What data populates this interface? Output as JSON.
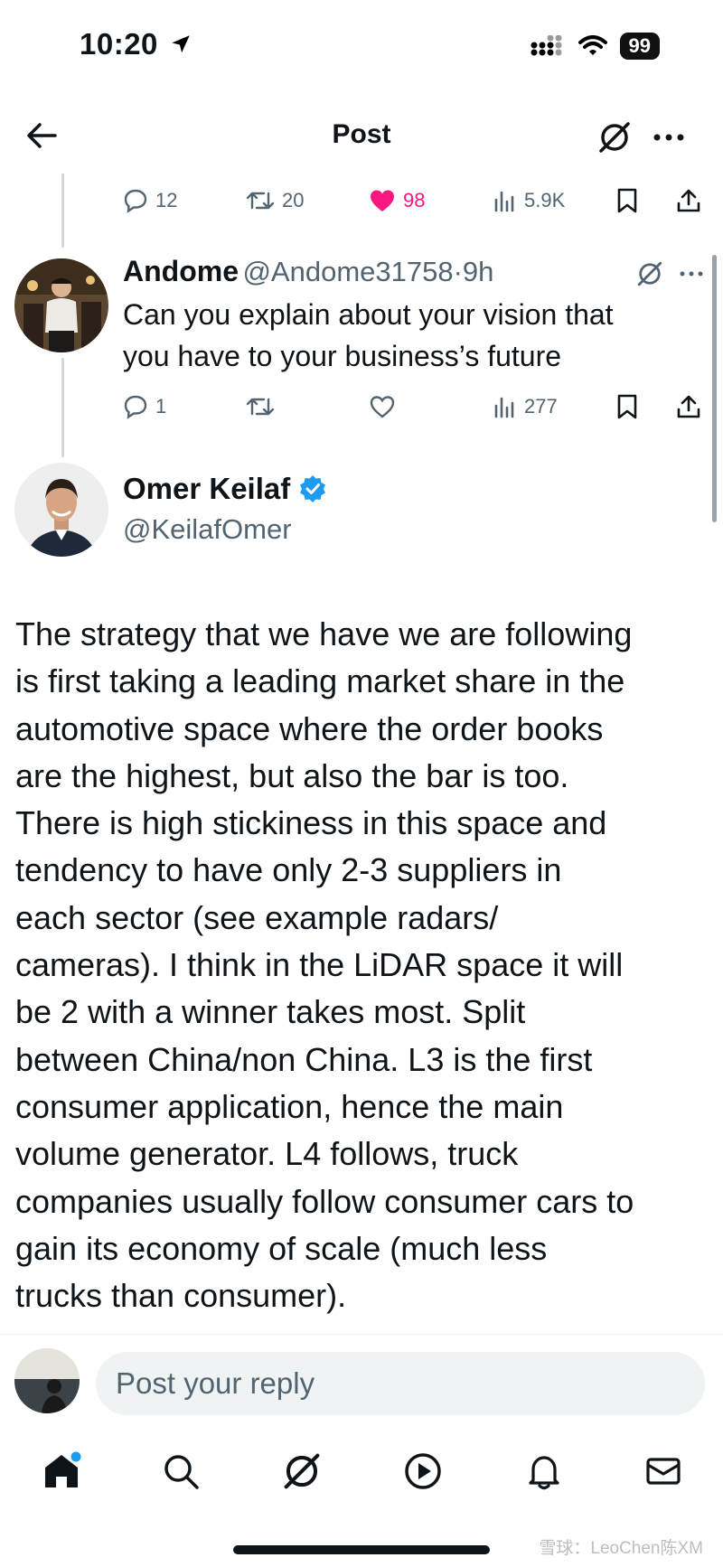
{
  "status_bar": {
    "time": "10:20",
    "battery": "99"
  },
  "header": {
    "title": "Post"
  },
  "parent_post": {
    "replies": "12",
    "reposts": "20",
    "likes": "98",
    "views": "5.9K"
  },
  "reply": {
    "author_name": "Andome",
    "handle": "@Andome31758",
    "separator": "·",
    "time": "9h",
    "text_line1": "Can you explain about your vision that",
    "text_line2": "you have to your business’s future",
    "replies": "1",
    "views": "277"
  },
  "main_post": {
    "author_name": "Omer Keilaf",
    "handle": "@KeilafOmer",
    "text": "The strategy that we have we are following\nis first taking a leading market share in the\nautomotive space where the order books\nare the highest, but also the bar is too.\nThere is high stickiness in this space and\ntendency to have only 2-3 suppliers in\neach sector (see example radars/\ncameras). I think in the LiDAR space it will\nbe 2 with a winner takes most. Split\nbetween China/non China. L3 is the first\nconsumer application, hence the main\nvolume generator. L4 follows, truck\ncompanies usually follow consumer cars to\ngain its economy of scale (much less\ntrucks than consumer)."
  },
  "composer": {
    "placeholder": "Post your reply"
  },
  "bottom_nav": {
    "items": [
      "home-icon",
      "search-icon",
      "grok-icon",
      "video-icon",
      "notifications-icon",
      "messages-icon"
    ]
  },
  "watermark": "雪球：LeoChen陈XM",
  "colors": {
    "like": "#f91880",
    "verified": "#1d9bf0",
    "muted": "#536471",
    "notification_dot": "#1d9bf0"
  }
}
